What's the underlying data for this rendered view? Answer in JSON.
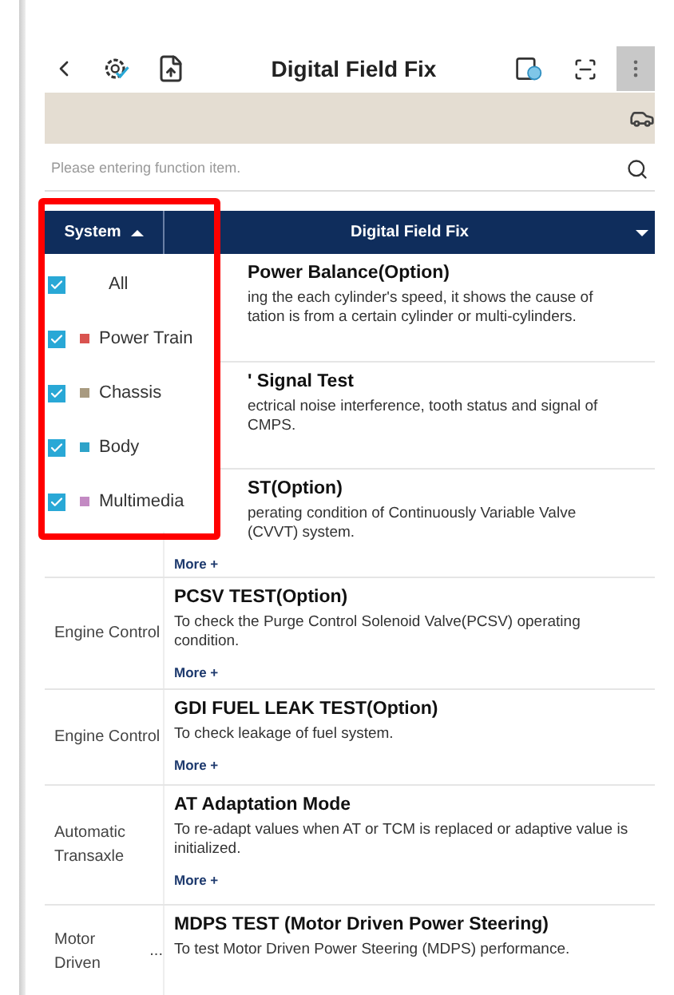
{
  "header": {
    "title": "Digital Field Fix"
  },
  "search": {
    "placeholder": "Please entering function item."
  },
  "table": {
    "columns": [
      {
        "label": "System",
        "sort_ascending": true
      },
      {
        "label": "Digital Field Fix"
      }
    ],
    "rows": [
      {
        "title": "Power Balance(Option)",
        "description": "ing the each cylinder's speed, it shows the cause of\ntation is from a certain cylinder or multi-cylinders."
      },
      {
        "title": "' Signal Test",
        "description": "ectrical noise interference, tooth status and signal of\nCMPS."
      },
      {
        "title": "ST(Option)",
        "description": "perating condition of Continuously Variable Valve\n(CVVT) system.",
        "more": "More +"
      },
      {
        "system": "Engine Control",
        "title": "PCSV TEST(Option)",
        "description": "To check the Purge Control Solenoid Valve(PCSV) operating condition.",
        "more": "More +"
      },
      {
        "system": "Engine Control",
        "title": "GDI FUEL LEAK TEST(Option)",
        "description": "To check leakage of fuel system.",
        "more": "More +"
      },
      {
        "system": "Automatic Transaxle",
        "title": "AT Adaptation Mode",
        "description": "To re-adapt values when AT or TCM is replaced or adaptive value is initialized.",
        "more": "More +"
      },
      {
        "system": "Motor Driven",
        "system_more": "...",
        "title": "MDPS TEST (Motor Driven Power Steering)",
        "description": "To test Motor Driven Power Steering (MDPS) performance."
      }
    ]
  },
  "system_menu": {
    "items": [
      {
        "label": "All",
        "checked": true
      },
      {
        "label": "Power Train",
        "checked": true,
        "color": "#d9534f"
      },
      {
        "label": "Chassis",
        "checked": true,
        "color": "#a89a80"
      },
      {
        "label": "Body",
        "checked": true,
        "color": "#2ea3c9"
      },
      {
        "label": "Multimedia",
        "checked": true,
        "color": "#c38ac3"
      }
    ]
  }
}
